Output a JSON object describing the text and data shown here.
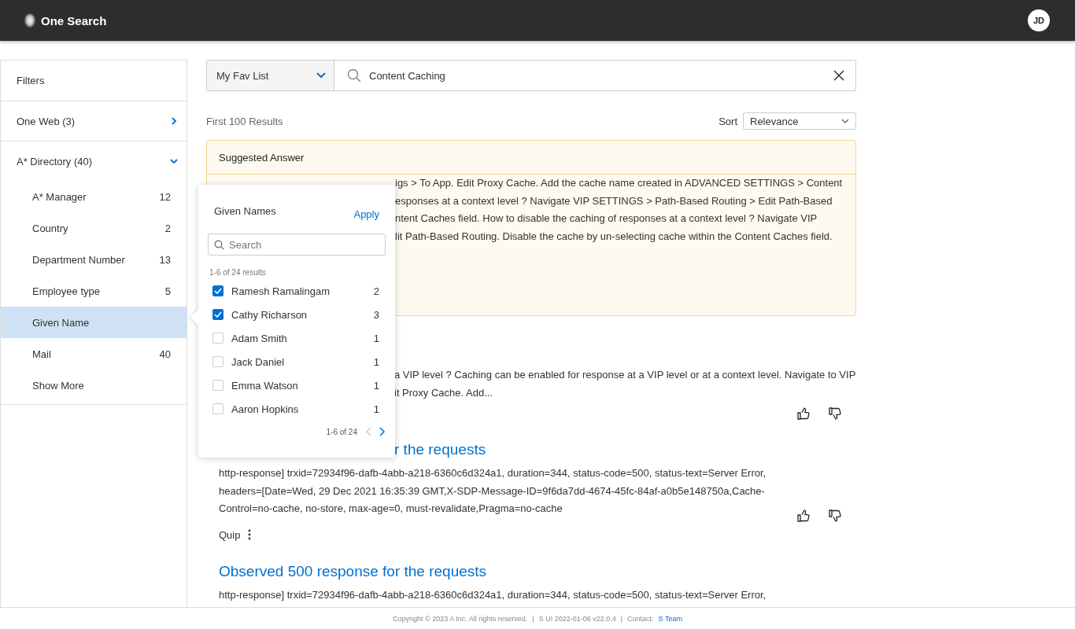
{
  "header": {
    "title": "One Search",
    "avatar": "JD"
  },
  "sidebar": {
    "title": "Filters",
    "groups": [
      {
        "label": "One Web (3)",
        "expanded": false
      },
      {
        "label": "A* Directory (40)",
        "expanded": true,
        "items": [
          {
            "label": "A* Manager",
            "count": "12",
            "selected": false
          },
          {
            "label": "Country",
            "count": "2",
            "selected": false
          },
          {
            "label": "Department Number",
            "count": "13",
            "selected": false
          },
          {
            "label": "Employee type",
            "count": "5",
            "selected": false
          },
          {
            "label": "Given Name",
            "selected": true
          },
          {
            "label": "Mail",
            "count": "40",
            "selected": false
          }
        ],
        "show_more": "Show More"
      }
    ]
  },
  "search": {
    "scope": "My Fav List",
    "query": "Content Caching"
  },
  "summary": "First 100 Results",
  "sort": {
    "label": "Sort",
    "value": "Relevance"
  },
  "suggested": {
    "title": "Suggested Answer",
    "lines": [
      {
        "text": "igs > To App. Edit Proxy Cache. Add the cache name created in ADVANCED SETTINGS > Content",
        "covered": true
      },
      {
        "text": "esponses at a context level ? Navigate VIP SETTINGS > Path-Based Routing > Edit Path-Based",
        "covered": true
      },
      {
        "text": "ntent Caches field. How to disable the caching of responses at a context level ? Navigate VIP",
        "covered": true
      },
      {
        "text": "lit Path-Based Routing. Disable the cache by un-selecting cache within the Content Caches field.",
        "covered": true
      }
    ]
  },
  "results": [
    {
      "lines": [
        {
          "text": "a VIP level ? Caching can be enabled for response at a VIP level or at a context level. Navigate to VIP",
          "covered": true
        },
        {
          "text": "it Proxy Cache. Add...",
          "covered": true
        }
      ],
      "feedback": true
    },
    {
      "title": {
        "text": "r the requests",
        "covered": true
      },
      "lines": [
        {
          "text": "http-response] trxid=72934f96-dafb-4abb-a218-6360c6d324a1, duration=344, status-code=500, status-text=Server Error,"
        },
        {
          "text": "headers=[Date=Wed, 29 Dec 2021 16:35:39 GMT,X-SDP-Message-ID=9f6da7dd-4674-45fc-84af-a0b5e148750a,Cache-"
        },
        {
          "text": "Control=no-cache, no-store, max-age=0, must-revalidate,Pragma=no-cache"
        }
      ],
      "feedback": true,
      "source": "Quip"
    },
    {
      "title": {
        "text": "Observed 500 response for the requests"
      },
      "lines": [
        {
          "text": "http-response] trxid=72934f96-dafb-4abb-a218-6360c6d324a1, duration=344, status-code=500, status-text=Server Error,"
        }
      ]
    }
  ],
  "popover": {
    "title": "Given Names",
    "apply": "Apply",
    "search_placeholder": "Search",
    "range": "1-6  of 24 results",
    "options": [
      {
        "label": "Ramesh Ramalingam",
        "count": "2",
        "checked": true
      },
      {
        "label": "Cathy Richarson",
        "count": "3",
        "checked": true
      },
      {
        "label": "Adam Smith",
        "count": "1",
        "checked": false
      },
      {
        "label": "Jack Daniel",
        "count": "1",
        "checked": false
      },
      {
        "label": "Emma Watson",
        "count": "1",
        "checked": false
      },
      {
        "label": "Aaron Hopkins",
        "count": "1",
        "checked": false
      }
    ],
    "pager": {
      "text": "1-6 of 24",
      "prev_disabled": true,
      "next_disabled": false
    }
  },
  "footer": [
    {
      "text": "Copyright © 2023 A Inc. All rights reserved.",
      "kind": "text"
    },
    {
      "text": "|",
      "kind": "sep"
    },
    {
      "text": "S UI 2022-01-06 v22.0.4",
      "kind": "text"
    },
    {
      "text": "|",
      "kind": "sep"
    },
    {
      "text": "Contact:",
      "kind": "text"
    },
    {
      "text": "S Team",
      "kind": "link"
    }
  ]
}
